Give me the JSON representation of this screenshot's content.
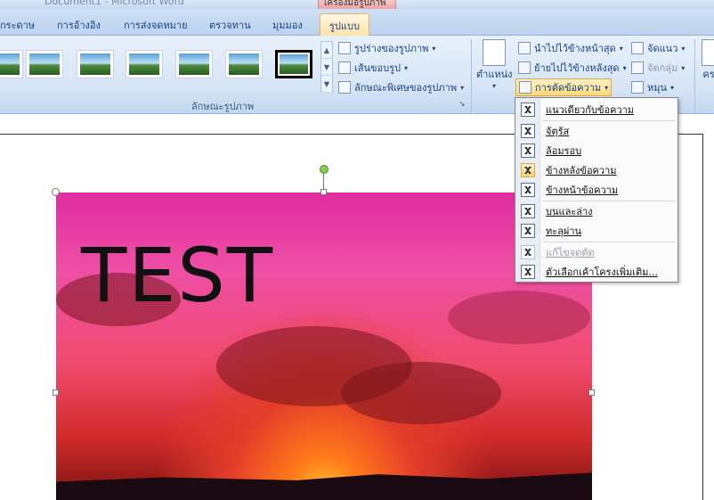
{
  "window": {
    "title": "Document1 - Microsoft Word",
    "context_tab": "เครื่องมือรูปภาพ"
  },
  "tabs": [
    {
      "label": "กระดาษ"
    },
    {
      "label": "การอ้างอิง"
    },
    {
      "label": "การส่งจดหมาย"
    },
    {
      "label": "ตรวจทาน"
    },
    {
      "label": "มุมมอง"
    },
    {
      "label": "รูปแบบ",
      "active": true
    }
  ],
  "ribbon": {
    "picture_styles_group": "ลักษณะรูปภาพ",
    "shape_button": "รูปร่างของรูปภาพ",
    "border_button": "เส้นขอบรูป",
    "effects_button": "ลักษณะพิเศษของรูปภาพ",
    "position_button": "ตำแหน่ง",
    "bring_front": "นำไปไว้ข้างหน้าสุด",
    "send_back": "ย้ายไปไว้ข้างหลังสุด",
    "text_wrap": "การตัดข้อความ",
    "align": "จัดแนว",
    "group": "จัดกลุ่ม",
    "rotate": "หมุน",
    "partial_label": "คร"
  },
  "wrap_menu": {
    "items": [
      {
        "label": "แนวเดียวกับข้อความ",
        "selected": false,
        "disabled": false
      },
      {
        "label": "จัตุรัส",
        "selected": false,
        "disabled": false
      },
      {
        "label": "ล้อมรอบ",
        "selected": false,
        "disabled": false
      },
      {
        "label": "ข้างหลังข้อความ",
        "selected": true,
        "disabled": false
      },
      {
        "label": "ข้างหน้าข้อความ",
        "selected": false,
        "disabled": false
      },
      {
        "label": "บนและล่าง",
        "selected": false,
        "disabled": false
      },
      {
        "label": "ทะลุผ่าน",
        "selected": false,
        "disabled": false
      },
      {
        "label": "แก้ไขจุดตัด",
        "selected": false,
        "disabled": true
      },
      {
        "label": "ตัวเลือกเค้าโครงเพิ่มเติม...",
        "selected": false,
        "disabled": false
      }
    ]
  },
  "document": {
    "image_text": "TEST"
  },
  "colors": {
    "ribbon": "#d5e4f5",
    "active_tab": "#ffe2a6",
    "context": "#e9a0a0"
  }
}
